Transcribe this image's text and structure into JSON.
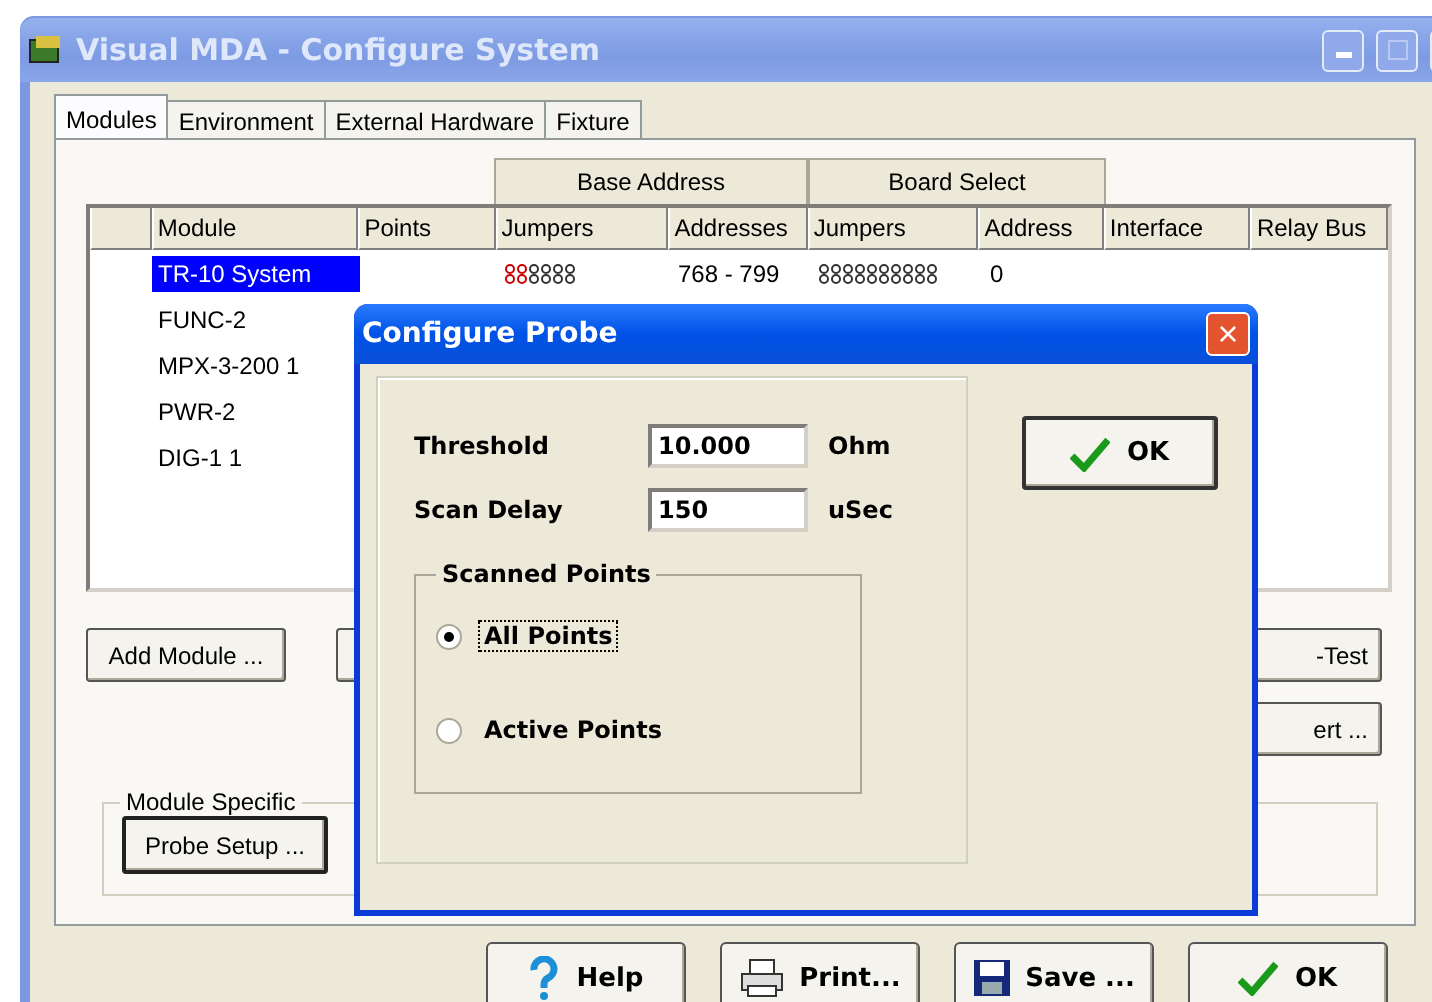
{
  "window": {
    "title": "Visual MDA - Configure System"
  },
  "tabs": [
    {
      "label": "Modules",
      "selected": true
    },
    {
      "label": "Environment",
      "selected": false
    },
    {
      "label": "External Hardware",
      "selected": false
    },
    {
      "label": "Fixture",
      "selected": false
    }
  ],
  "table": {
    "group_headers": [
      "Base Address",
      "Board Select"
    ],
    "columns": [
      "Module",
      "Points",
      "Jumpers",
      "Addresses",
      "Jumpers",
      "Address",
      "Interface",
      "Relay Bus"
    ],
    "rows": [
      {
        "module": "TR-10 System",
        "selected": true,
        "jumpers_shown": true,
        "addresses": "768 - 799",
        "address": "0"
      },
      {
        "module": "FUNC-2",
        "selected": false,
        "jumpers_shown": false
      },
      {
        "module": "MPX-3-200  1",
        "selected": false,
        "jumpers_shown": false
      },
      {
        "module": "PWR-2",
        "selected": false,
        "jumpers_shown": false
      },
      {
        "module": "DIG-1  1",
        "selected": false,
        "jumpers_shown": false
      }
    ]
  },
  "panel_buttons": {
    "add": "Add Module ...",
    "right": [
      "-Test",
      "ert ..."
    ]
  },
  "module_specific": {
    "legend": "Module Specific",
    "button": "Probe Setup ..."
  },
  "footer_buttons": [
    {
      "label": "Help",
      "kind": "help"
    },
    {
      "label": "Print...",
      "kind": "print"
    },
    {
      "label": "Save ...",
      "kind": "save"
    },
    {
      "label": "OK",
      "kind": "ok"
    }
  ],
  "dialog": {
    "title": "Configure Probe",
    "close": "×",
    "fields": [
      {
        "label": "Threshold",
        "value": "10.000",
        "unit": "Ohm"
      },
      {
        "label": "Scan Delay",
        "value": "150",
        "unit": "uSec"
      }
    ],
    "group": {
      "legend": "Scanned Points",
      "options": [
        {
          "label": "All Points",
          "selected": true,
          "focused": true
        },
        {
          "label": "Active Points",
          "selected": false,
          "focused": false
        }
      ]
    },
    "ok": "OK"
  }
}
